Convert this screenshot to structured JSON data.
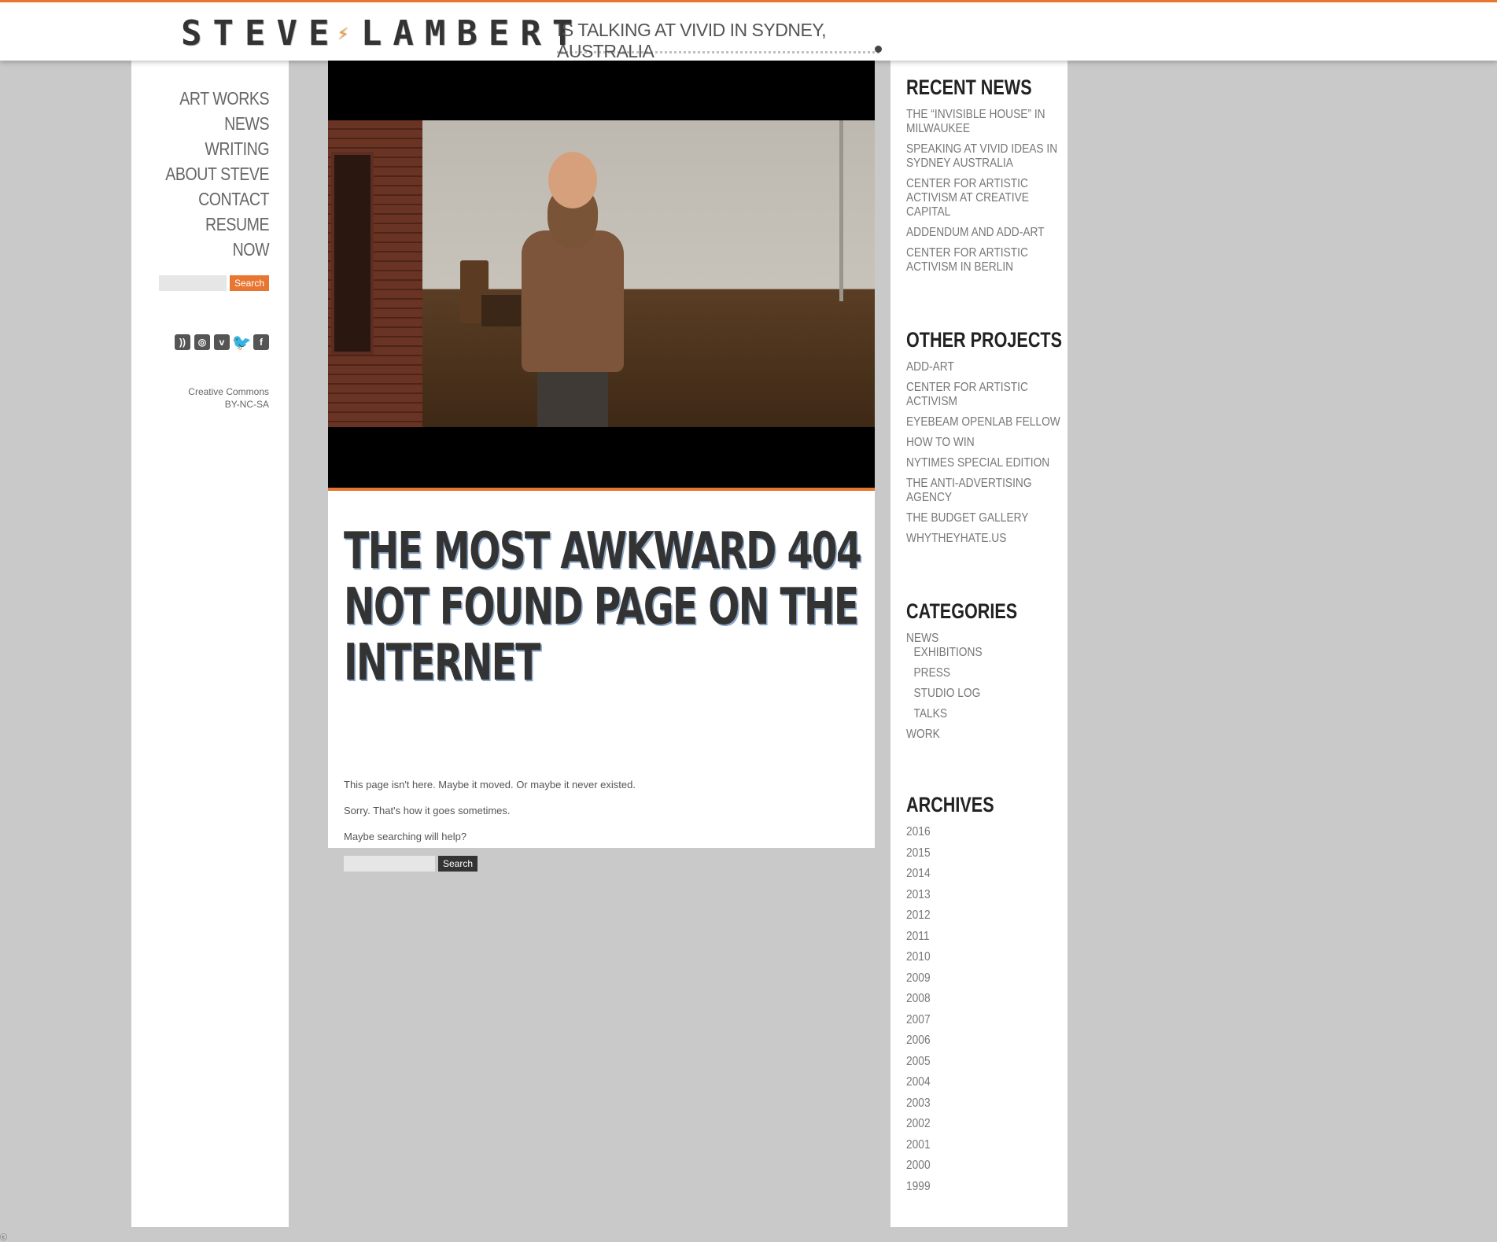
{
  "header": {
    "logo_left": "STEVE",
    "logo_bolt": "⚡",
    "logo_right": "LAMBERT",
    "tagline": "IS TALKING AT VIVID IN SYDNEY, AUSTRALIA"
  },
  "nav": {
    "items": [
      "ART WORKS",
      "NEWS",
      "WRITING",
      "ABOUT STEVE",
      "CONTACT",
      "RESUME",
      "NOW"
    ]
  },
  "sidebar_search": {
    "button_label": "Search",
    "value": ""
  },
  "social": {
    "icons": [
      "rss-icon",
      "instagram-icon",
      "vimeo-icon",
      "twitter-icon",
      "facebook-icon"
    ]
  },
  "license": {
    "line1": "Creative Commons",
    "line2": "BY-NC-SA"
  },
  "main": {
    "headline": "THE MOST AWKWARD 404 NOT FOUND PAGE ON THE INTERNET",
    "p1": "This page isn't here. Maybe it moved. Or maybe it never existed.",
    "p2": "Sorry. That's how it goes sometimes.",
    "p3": "Maybe searching will help?",
    "search_button": "Search"
  },
  "recent_news": {
    "title": "RECENT NEWS",
    "items": [
      "THE “INVISIBLE HOUSE” IN MILWAUKEE",
      "SPEAKING AT VIVID IDEAS IN SYDNEY AUSTRALIA",
      "CENTER FOR ARTISTIC ACTIVISM AT CREATIVE CAPITAL",
      "ADDENDUM AND ADD-ART",
      "CENTER FOR ARTISTIC ACTIVISM IN BERLIN"
    ]
  },
  "other_projects": {
    "title": "OTHER PROJECTS",
    "items": [
      "ADD-ART",
      "CENTER FOR ARTISTIC ACTIVISM",
      "EYEBEAM OPENLAB FELLOW",
      "HOW TO WIN",
      "NYTIMES SPECIAL EDITION",
      "THE ANTI-ADVERTISING AGENCY",
      "THE BUDGET GALLERY",
      "WHYTHEYHATE.US"
    ]
  },
  "categories": {
    "title": "CATEGORIES",
    "items": [
      "NEWS",
      "EXHIBITIONS",
      "PRESS",
      "STUDIO LOG",
      "TALKS",
      "WORK"
    ]
  },
  "archives": {
    "title": "ARCHIVES",
    "items": [
      "2016",
      "2015",
      "2014",
      "2013",
      "2012",
      "2011",
      "2010",
      "2009",
      "2008",
      "2007",
      "2006",
      "2005",
      "2004",
      "2003",
      "2002",
      "2001",
      "2000",
      "1999"
    ]
  },
  "colors": {
    "accent": "#e87530",
    "background": "#c9c9c9",
    "text": "#333333"
  },
  "corner_mark": "ⓒ"
}
